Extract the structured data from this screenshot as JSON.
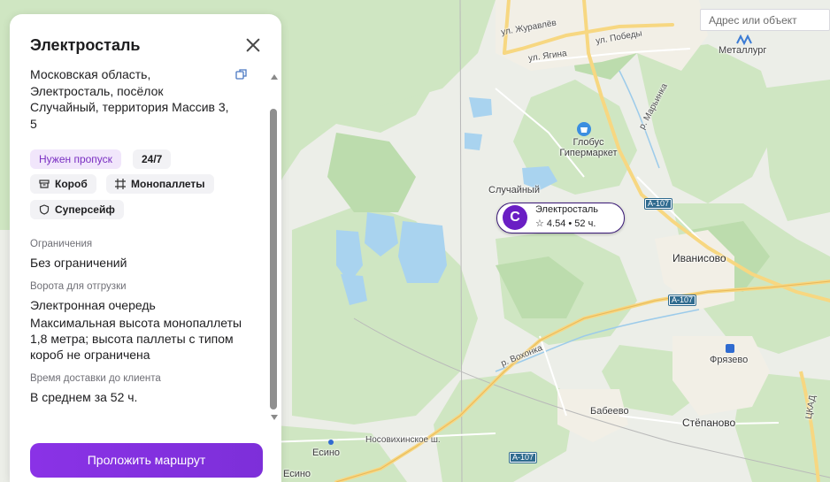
{
  "search": {
    "placeholder": "Адрес или объект"
  },
  "map": {
    "labels": {
      "street_zhuravleva": "ул. Журавлёв",
      "street_pobedy": "ул. Победы",
      "street_yagina": "ул. Ягина",
      "street_marshala": "р. Марьинка",
      "street_voronka": "р. Вохонка",
      "street_nosovikhinskoe": "Носовихинское ш.",
      "street_tskad": "ЦКАД",
      "metallurg": "Металлург",
      "globus": "Глобус\nГипермаркет",
      "sluchainy": "Случайный",
      "ivanisovo": "Иванисово",
      "fryazevo": "Фрязево",
      "babeevo": "Бабеево",
      "stepanovo": "Стёпаново",
      "esino_1": "Есино",
      "esino_2": "Есино"
    },
    "road_shields": [
      "А-107",
      "А-107",
      "А-107"
    ]
  },
  "pin": {
    "avatar_letter": "С",
    "title": "Электросталь",
    "meta": "☆ 4.54 • 52 ч."
  },
  "panel": {
    "title": "Электросталь",
    "address": "Московская область, Электросталь, посёлок Случайный, территория Массив 3, 5",
    "chips": {
      "pass": "Нужен пропуск",
      "hours": "24/7",
      "box": "Короб",
      "monopallets": "Монопаллеты",
      "supersafe": "Суперсейф"
    },
    "restrictions_label": "Ограничения",
    "restrictions_value": "Без ограничений",
    "gates_label": "Ворота для отгрузки",
    "gates_value": "Электронная очередь",
    "gates_note": "Максимальная высота монопаллеты 1,8 метра; высота паллеты с типом короб не ограничена",
    "delivery_label": "Время доставки до клиента",
    "delivery_value": "В среднем за 52 ч.",
    "route_button": "Проложить маршрут"
  },
  "colors": {
    "accent": "#7b2ee0",
    "pin_avatar": "#6a1ec4",
    "pass_chip_bg": "#f1e6fb",
    "pass_chip_text": "#7a2fc2"
  },
  "icons": {
    "close": "close-icon",
    "copy": "copy-icon",
    "box": "box-icon",
    "monopallet": "grid-icon",
    "supersafe": "shield-icon",
    "store": "shopping-bag-icon",
    "train": "train-icon",
    "metro": "metro-icon",
    "star": "star-icon"
  }
}
